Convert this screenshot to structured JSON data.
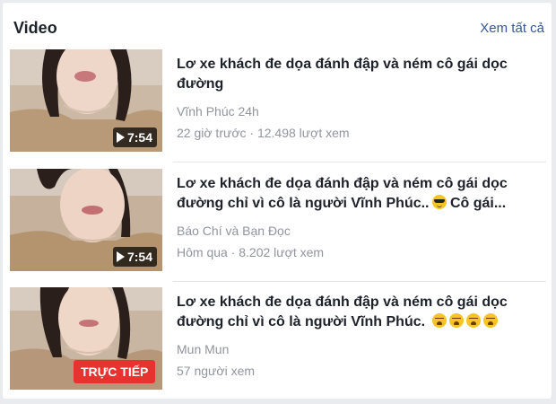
{
  "section": {
    "title": "Video",
    "see_all": "Xem tất cả"
  },
  "videos": [
    {
      "title": "Lơ xe khách đe dọa đánh đập và ném cô gái dọc đường",
      "source": "Vĩnh Phúc 24h",
      "meta": "22 giờ trước · 12.498 lượt xem",
      "duration": "7:54"
    },
    {
      "title": "Lơ xe khách đe dọa đánh đập và ném cô gái dọc đường chỉ vì cô là người Vĩnh Phúc..",
      "title_tail": " Cô gái...",
      "title_emoji": "smiling-face-with-sunglasses",
      "source": "Báo Chí và Bạn Đọc",
      "meta": "Hôm qua · 8.202 lượt xem",
      "duration": "7:54"
    },
    {
      "title": "Lơ xe khách đe dọa đánh đập và ném cô gái dọc đường chỉ vì cô là người Vĩnh Phúc.",
      "title_emoji": "weary-face",
      "title_emoji_count": 4,
      "source": "Mun Mun",
      "meta": "57 người xem",
      "live_label": "TRỰC TIẾP"
    }
  ],
  "colors": {
    "link": "#365899",
    "live": "#e8322f",
    "secondary_text": "#90949c"
  }
}
